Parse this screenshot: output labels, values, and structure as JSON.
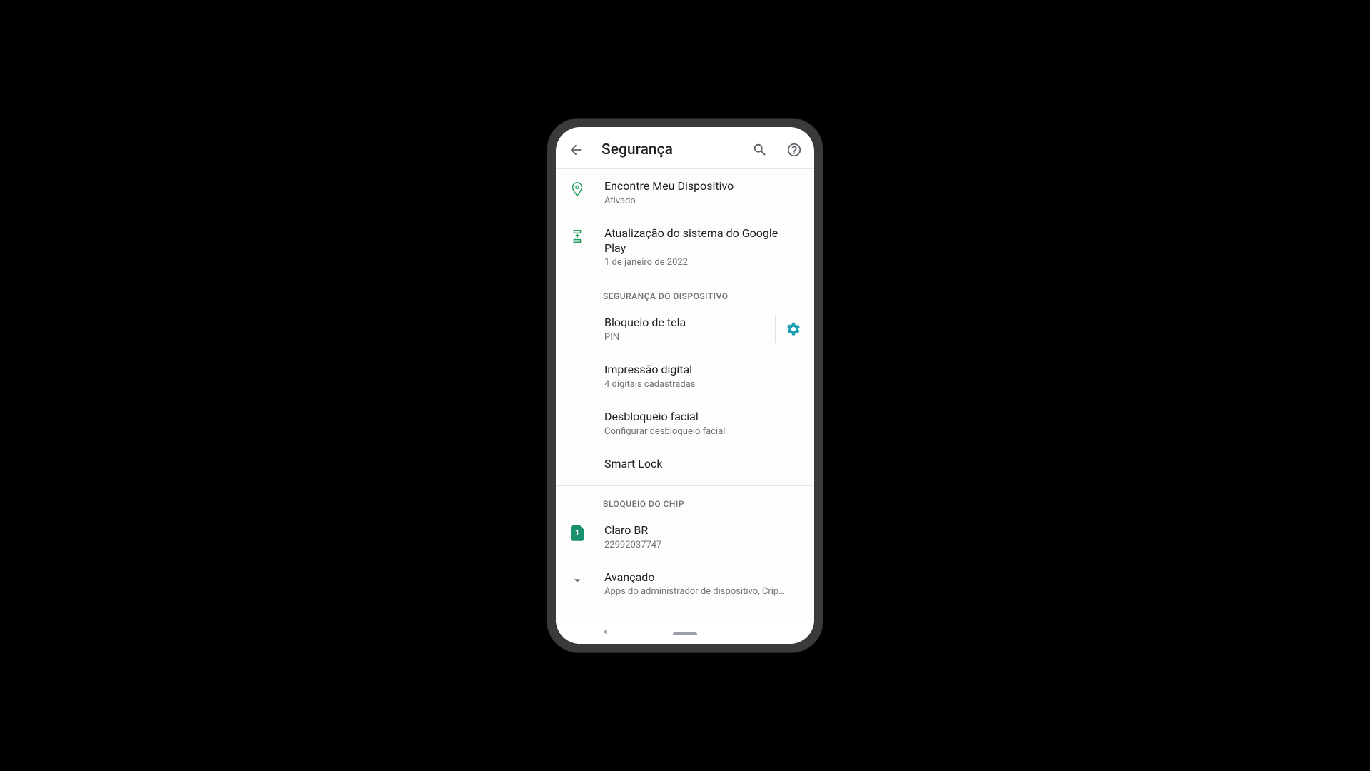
{
  "header": {
    "title": "Segurança"
  },
  "items": {
    "find_device": {
      "title": "Encontre Meu Dispositivo",
      "sub": "Ativado"
    },
    "play_update": {
      "title": "Atualização do sistema do Google Play",
      "sub": "1 de janeiro de 2022"
    }
  },
  "sections": {
    "device_security": "SEGURANÇA DO DISPOSITIVO",
    "sim_lock": "BLOQUEIO DO CHIP"
  },
  "device_security": {
    "screen_lock": {
      "title": "Bloqueio de tela",
      "sub": "PIN"
    },
    "fingerprint": {
      "title": "Impressão digital",
      "sub": "4 digitais cadastradas"
    },
    "face_unlock": {
      "title": "Desbloqueio facial",
      "sub": "Configurar desbloqueio facial"
    },
    "smart_lock": {
      "title": "Smart Lock"
    }
  },
  "sim": {
    "badge": "1",
    "carrier": {
      "title": "Claro BR",
      "sub": "22992037747"
    }
  },
  "advanced": {
    "title": "Avançado",
    "sub": "Apps do administrador de dispositivo, Crip…"
  }
}
